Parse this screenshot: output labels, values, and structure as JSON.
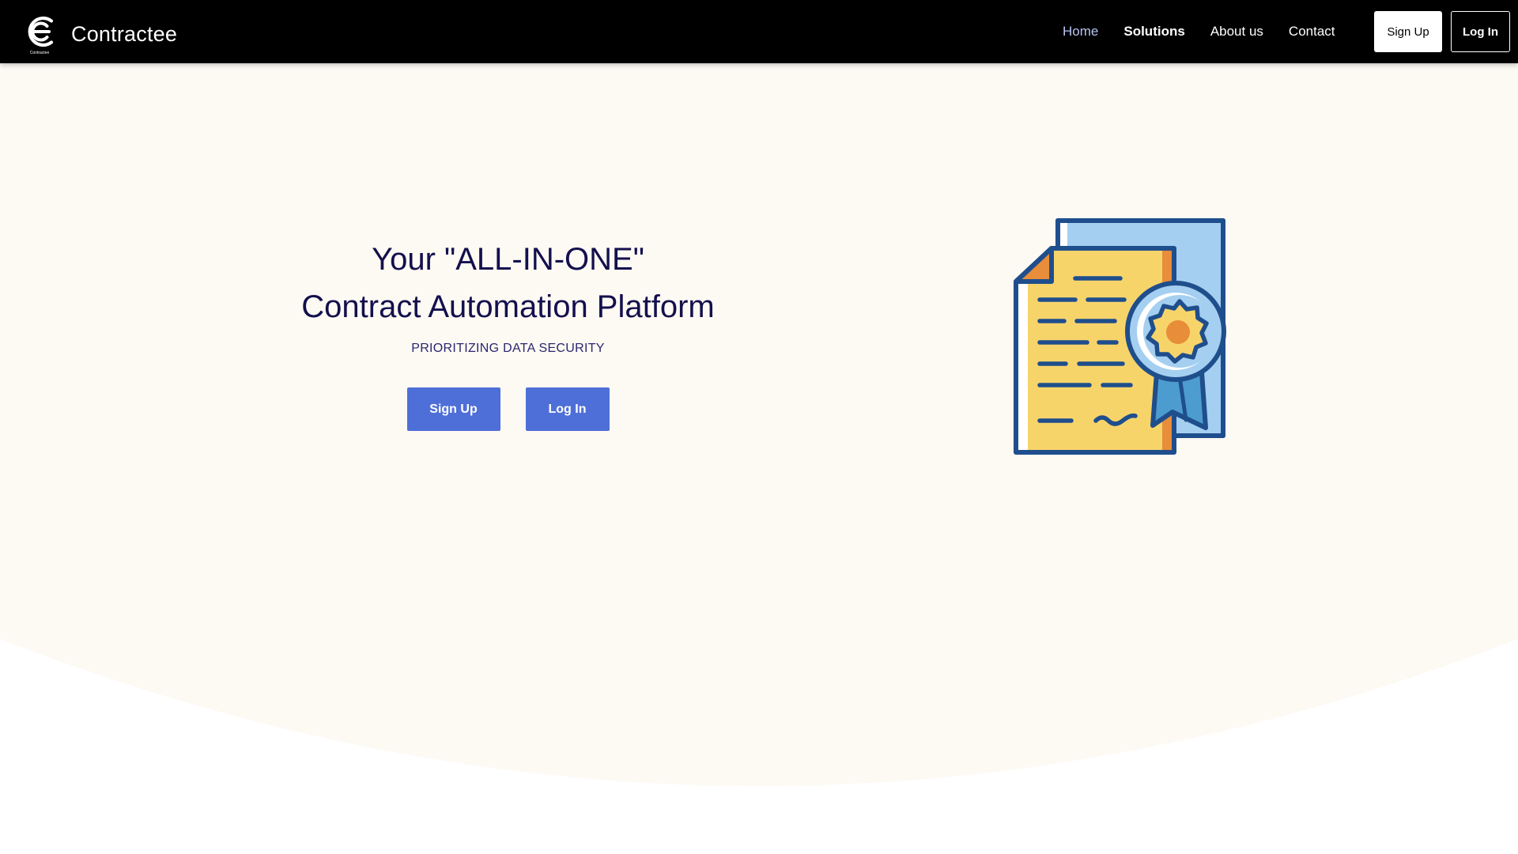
{
  "brand": {
    "name": "Contractee",
    "logo_small_text": "Contractee"
  },
  "nav": {
    "links": [
      {
        "label": "Home",
        "state": "active"
      },
      {
        "label": "Solutions",
        "state": "bold"
      },
      {
        "label": "About us",
        "state": "normal"
      },
      {
        "label": "Contact",
        "state": "normal"
      }
    ],
    "signup_label": "Sign Up",
    "login_label": "Log In"
  },
  "hero": {
    "headline_line1": "Your \"ALL-IN-ONE\"",
    "headline_line2": "Contract Automation Platform",
    "subheadline": "PRIORITIZING DATA SECURITY",
    "signup_label": "Sign Up",
    "login_label": "Log In"
  },
  "colors": {
    "navbar_bg": "#000000",
    "hero_bg": "#fdf9f3",
    "headline": "#13104d",
    "button": "#4f6fd8",
    "active_link": "#b8c4f2"
  },
  "icons": {
    "brand": "contractee-e-logo-icon",
    "hero": "certified-contract-document-icon"
  }
}
